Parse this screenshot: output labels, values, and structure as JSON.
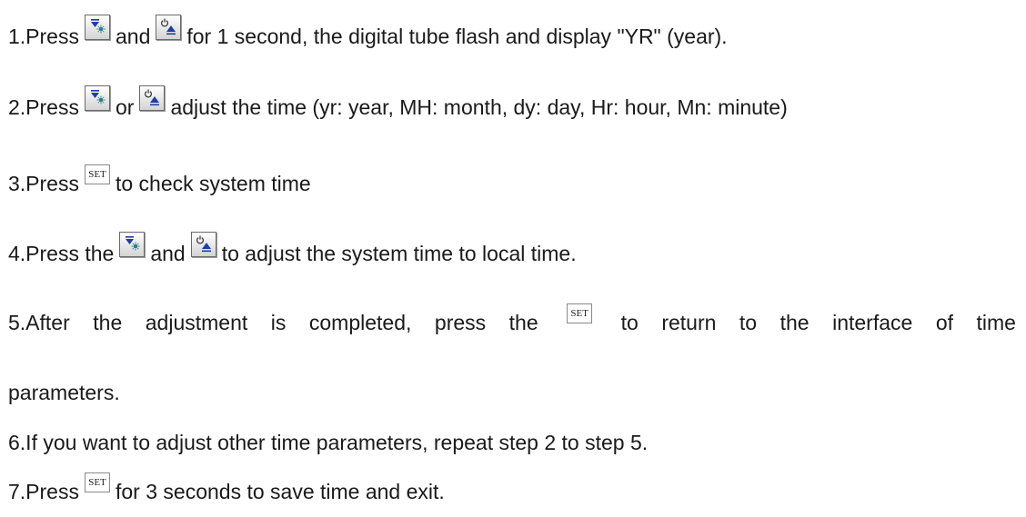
{
  "steps": [
    {
      "segments": [
        "1.Press",
        "and",
        "for 1 second, the digital tube flash and display \"YR\" (year)."
      ]
    },
    {
      "segments": [
        "2.Press",
        "or",
        "adjust the time (yr: year, MH: month, dy: day, Hr: hour, Mn: minute)"
      ]
    },
    {
      "segments": [
        "3.Press",
        "to check system time"
      ]
    },
    {
      "segments": [
        "4.Press the",
        "and",
        "to adjust the system time to local time."
      ]
    },
    {
      "segments": [
        "5.After",
        "the",
        "adjustment",
        "is",
        "completed,",
        "press",
        "the",
        "to",
        "return",
        "to",
        "the",
        "interface",
        "of",
        "time"
      ],
      "continuation": "parameters."
    },
    {
      "segments": [
        "6.If you want to adjust other time parameters, repeat step 2 to step 5."
      ]
    },
    {
      "segments": [
        "7.Press",
        "for 3 seconds to save time and exit."
      ]
    }
  ],
  "keys": {
    "set_label": "SET",
    "down_icon": "down-triangle-light-icon",
    "power_up_icon": "power-up-triangle-icon"
  },
  "colors": {
    "text": "#1a1a1a",
    "icon_blue": "#1c3fa8",
    "icon_teal": "#2a7f8a"
  }
}
